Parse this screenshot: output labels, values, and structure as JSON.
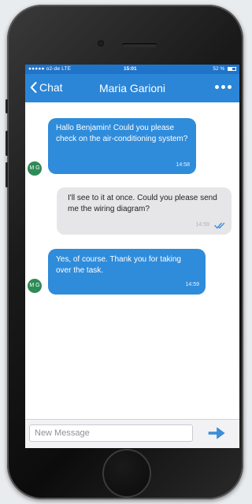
{
  "status_bar": {
    "carrier": "●●●●● o2-de  LTE",
    "time": "15:01",
    "battery": "52 %",
    "battery_level": 0.52
  },
  "nav": {
    "back_label": "Chat",
    "title": "Maria Garioni"
  },
  "messages": [
    {
      "direction": "in",
      "text": "Hallo Benjamin! Could you please check on the air-conditioning system?",
      "time": "14:58",
      "avatar": "M G"
    },
    {
      "direction": "out",
      "text": "I'll see to it at once. Could you please send me the wiring diagram?",
      "time": "14:59",
      "status_icon": "double-check-icon"
    },
    {
      "direction": "in",
      "text": "Yes, of course. Thank you for taking over the task.",
      "time": "14:59",
      "avatar": "M G"
    }
  ],
  "composer": {
    "placeholder": "New Message",
    "value": ""
  },
  "colors": {
    "accent": "#2b86d8",
    "incoming_bubble": "#2f8cdb",
    "outgoing_bubble": "#e6e6e8",
    "avatar": "#2e8b57"
  },
  "icons": {
    "back": "chevron-left-icon",
    "menu": "more-dots-icon",
    "send": "send-arrow-icon"
  }
}
